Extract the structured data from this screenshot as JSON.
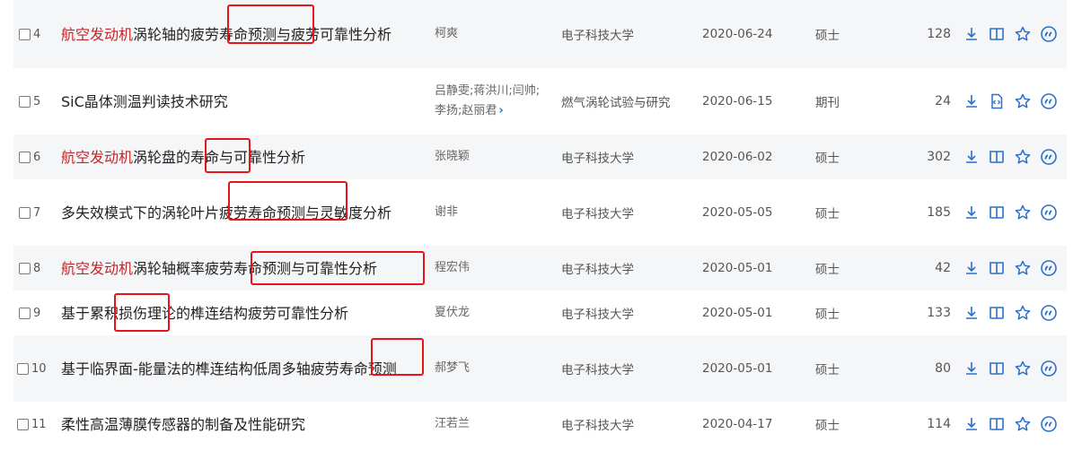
{
  "rows": [
    {
      "number": "4",
      "title_pre": "",
      "title_keyword": "航空发动机",
      "title_post": "涡轮轴的疲劳寿命预测与疲劳可靠性分析",
      "authors": "柯爽",
      "authors_more": "",
      "source": "电子科技大学",
      "date": "2020-06-24",
      "type": "硕士",
      "downloads": "128",
      "reader_icon": "book-icon"
    },
    {
      "number": "5",
      "title_pre": "SiC晶体测温判读技术研究",
      "title_keyword": "",
      "title_post": "",
      "authors": "吕静雯;蒋洪川;闫帅;李扬;赵丽君",
      "authors_more": "›",
      "source": "燃气涡轮试验与研究",
      "date": "2020-06-15",
      "type": "期刊",
      "downloads": "24",
      "reader_icon": "html-reader-icon"
    },
    {
      "number": "6",
      "title_pre": "",
      "title_keyword": "航空发动机",
      "title_post": "涡轮盘的寿命与可靠性分析",
      "authors": "张晓颖",
      "authors_more": "",
      "source": "电子科技大学",
      "date": "2020-06-02",
      "type": "硕士",
      "downloads": "302",
      "reader_icon": "book-icon"
    },
    {
      "number": "7",
      "title_pre": "多失效模式下的涡轮叶片疲劳寿命预测与灵敏度分析",
      "title_keyword": "",
      "title_post": "",
      "authors": "谢非",
      "authors_more": "",
      "source": "电子科技大学",
      "date": "2020-05-05",
      "type": "硕士",
      "downloads": "185",
      "reader_icon": "book-icon"
    },
    {
      "number": "8",
      "title_pre": "",
      "title_keyword": "航空发动机",
      "title_post": "涡轮轴概率疲劳寿命预测与可靠性分析",
      "authors": "程宏伟",
      "authors_more": "",
      "source": "电子科技大学",
      "date": "2020-05-01",
      "type": "硕士",
      "downloads": "42",
      "reader_icon": "book-icon"
    },
    {
      "number": "9",
      "title_pre": "基于累积损伤理论的榫连结构疲劳可靠性分析",
      "title_keyword": "",
      "title_post": "",
      "authors": "夏伏龙",
      "authors_more": "",
      "source": "电子科技大学",
      "date": "2020-05-01",
      "type": "硕士",
      "downloads": "133",
      "reader_icon": "book-icon"
    },
    {
      "number": "10",
      "title_pre": "基于临界面-能量法的榫连结构低周多轴疲劳寿命预测",
      "title_keyword": "",
      "title_post": "",
      "authors": "郝梦飞",
      "authors_more": "",
      "source": "电子科技大学",
      "date": "2020-05-01",
      "type": "硕士",
      "downloads": "80",
      "reader_icon": "book-icon"
    },
    {
      "number": "11",
      "title_pre": "柔性高温薄膜传感器的制备及性能研究",
      "title_keyword": "",
      "title_post": "",
      "authors": "汪若兰",
      "authors_more": "",
      "source": "电子科技大学",
      "date": "2020-04-17",
      "type": "硕士",
      "downloads": "114",
      "reader_icon": "book-icon"
    }
  ],
  "colors": {
    "keyword": "#c0272d",
    "icon_blue": "#2c6fca",
    "alt_row": "#f5f6f8",
    "annotation_box": "#e5151c"
  },
  "action_icons": [
    "download-icon",
    "reader-icon",
    "favorite-star-icon",
    "quote-icon"
  ]
}
